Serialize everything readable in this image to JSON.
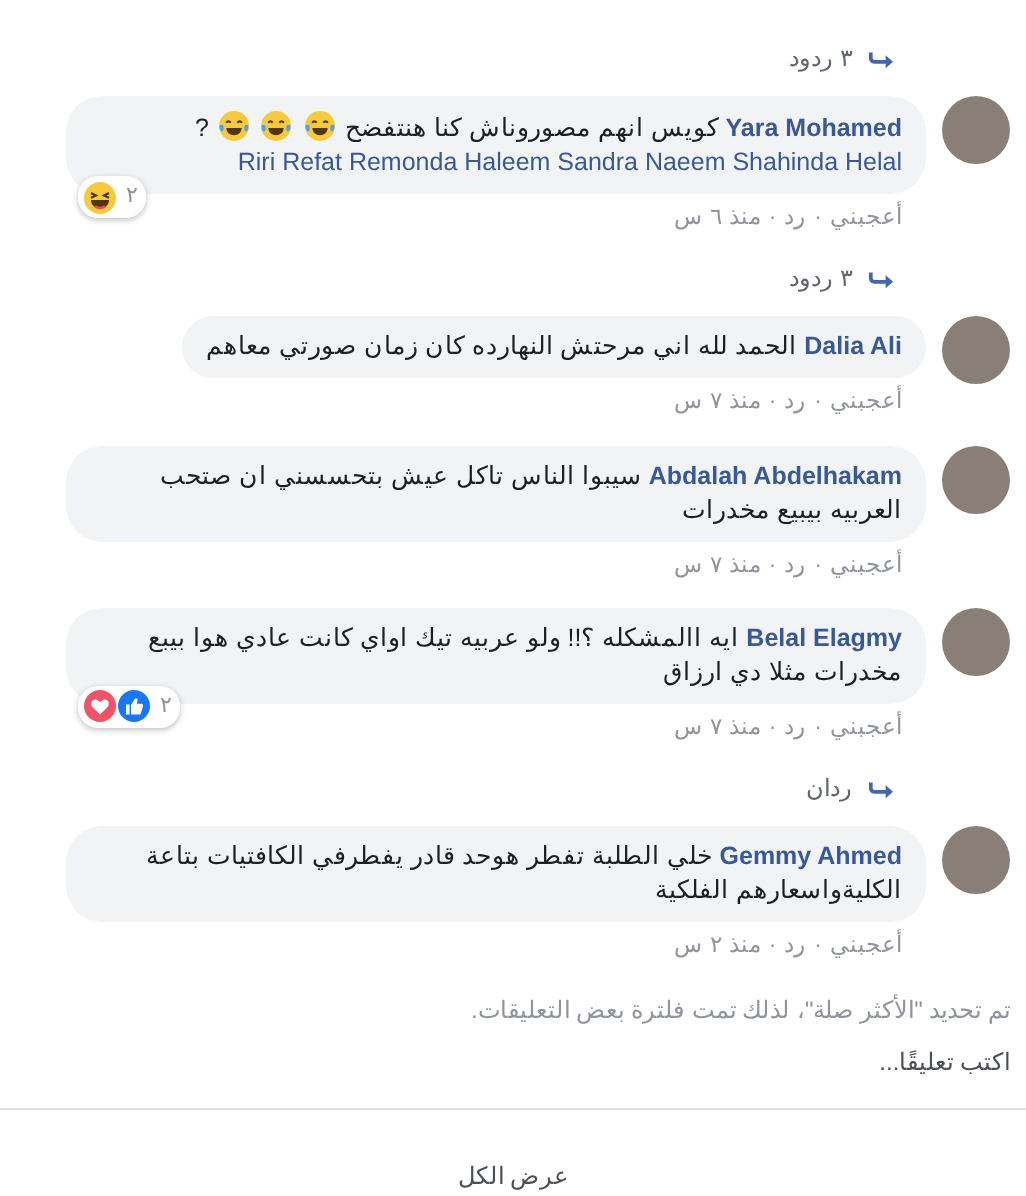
{
  "separator": "·",
  "thread": [
    {
      "kind": "replies",
      "text": "٣ ردود"
    },
    {
      "kind": "comment",
      "author": "Yara Mohamed",
      "parts": [
        {
          "kind": "text",
          "text": "كويس انهم مصوروناش كنا هنتفضح"
        },
        {
          "kind": "emoji"
        },
        {
          "kind": "emoji"
        },
        {
          "kind": "emoji"
        },
        {
          "kind": "text",
          "text": "?"
        },
        {
          "kind": "tag",
          "text": "Riri Refat Remonda Haleem Sandra Naeem Shahinda Helal"
        }
      ],
      "reactions": {
        "icons": [
          {
            "kind": "haha"
          }
        ],
        "count": "٢"
      },
      "actions": [
        "أعجبني",
        "رد"
      ],
      "time": "منذ ٦ س"
    },
    {
      "kind": "replies",
      "text": "٣ ردود"
    },
    {
      "kind": "comment",
      "author": "Dalia Ali",
      "parts": [
        {
          "kind": "text",
          "text": "الحمد لله اني مرحتش النهارده كان زمان صورتي معاهم"
        }
      ],
      "actions": [
        "أعجبني",
        "رد"
      ],
      "time": "منذ ٧ س"
    },
    {
      "kind": "comment",
      "author": "Abdalah Abdelhakam",
      "parts": [
        {
          "kind": "text",
          "text": "سيبوا الناس تاكل عيش بتحسسني ان صتحب العربيه بيبيع مخدرات"
        }
      ],
      "actions": [
        "أعجبني",
        "رد"
      ],
      "time": "منذ ٧ س"
    },
    {
      "kind": "comment",
      "author": "Belal Elagmy",
      "parts": [
        {
          "kind": "text",
          "text": "ايه االمشكله ؟!! ولو عربيه تيك اواي كانت عادي هوا بيبع مخدرات مثلا دي ارزاق"
        }
      ],
      "reactions": {
        "icons": [
          {
            "kind": "love"
          },
          {
            "kind": "like"
          }
        ],
        "count": "٢"
      },
      "actions": [
        "أعجبني",
        "رد"
      ],
      "time": "منذ ٧ س"
    },
    {
      "kind": "replies",
      "text": "ردان"
    },
    {
      "kind": "comment",
      "author": "Gemmy Ahmed",
      "parts": [
        {
          "kind": "text",
          "text": "خلي الطلبة تفطر هوحد قادر يفطرفي الكافتيات بتاعة الكليةواسعارهم الفلكية"
        }
      ],
      "actions": [
        "أعجبني",
        "رد"
      ],
      "time": "منذ ٢ س"
    }
  ],
  "filter_note": "تم تحديد \"الأكثر صلة\"، لذلك تمت فلترة بعض التعليقات.",
  "write_comment": "اكتب تعليقًا...",
  "view_all": "عرض الكل"
}
